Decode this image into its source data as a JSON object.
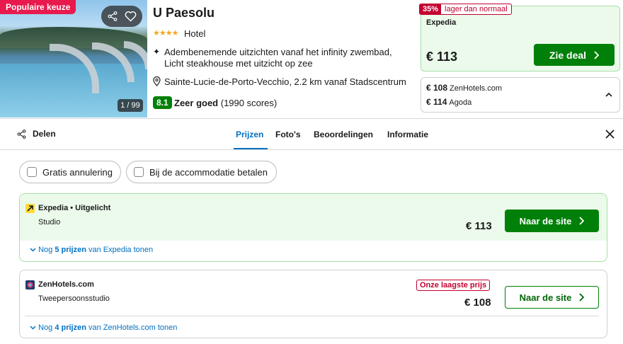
{
  "hotel": {
    "popular_badge": "Populaire keuze",
    "image_counter": "1 / 99",
    "name": "U Paesolu",
    "stars": "★★★★",
    "type": "Hotel",
    "features": "Adembenemende uitzichten vanaf het infinity zwembad, Licht steakhouse met uitzicht op zee",
    "location": "Sainte-Lucie-de-Porto-Vecchio, 2.2 km vanaf Stadscentrum",
    "rating_score": "8.1",
    "rating_label": "Zeer goed",
    "rating_count": "(1990 scores)"
  },
  "deal": {
    "discount_pct": "35%",
    "discount_text": "lager dan normaal",
    "provider": "Expedia",
    "price": "€ 113",
    "button": "Zie deal",
    "alternatives": [
      {
        "price": "€ 108",
        "provider": "ZenHotels.com"
      },
      {
        "price": "€ 114",
        "provider": "Agoda"
      }
    ]
  },
  "tabs": {
    "share": "Delen",
    "items": [
      "Prijzen",
      "Foto's",
      "Beoordelingen",
      "Informatie"
    ],
    "active": "Prijzen"
  },
  "filters": [
    "Gratis annulering",
    "Bij de accommodatie betalen"
  ],
  "offers": [
    {
      "provider": "Expedia • Uitgelicht",
      "room": "Studio",
      "price": "€ 113",
      "button": "Naar de site",
      "more_prefix": "Nog",
      "more_count": "5 prijzen",
      "more_suffix": "van Expedia tonen"
    },
    {
      "provider": "ZenHotels.com",
      "badge": "Onze laagste prijs",
      "room": "Tweepersoonsstudio",
      "price": "€ 108",
      "button": "Naar de site",
      "more_prefix": "Nog",
      "more_count": "4 prijzen",
      "more_suffix": "van ZenHotels.com tonen"
    }
  ],
  "colors": {
    "green": "#008009",
    "blue": "#0071c2",
    "red": "#c3002f",
    "pink": "#e8194c",
    "light_green": "#ebfaeb"
  }
}
